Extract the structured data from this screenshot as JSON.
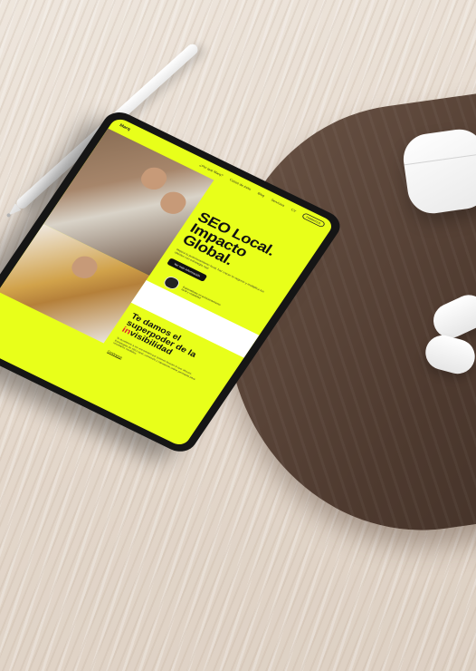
{
  "scene": {
    "description_colors": {
      "accent": "#e8ff1a",
      "wood_board": "#4e3a2f",
      "table": "#e4d8cc"
    }
  },
  "site": {
    "logo": "Marq",
    "nav_items": [
      "¿Por qué Marq?",
      "Casos de éxito",
      "Blog",
      "Servicios",
      "CV"
    ],
    "contact_label": "Hablemos",
    "hero": {
      "title_line1": "SEO Local.",
      "title_line2": "Impacto",
      "title_line3": "Global.",
      "subtitle": "Mejora tu posicionamiento local, haz crecer tu negocio y multiplica tus clientes con estrategia real.",
      "cta_label": "Ver más información"
    },
    "badge_text": "Especialistas en posicionamiento local y visibilidad",
    "section": {
      "title_line1": "Te damos el",
      "title_line2": "superpoder de la",
      "title_red": "in",
      "title_line3_rest": "visibilidad",
      "body": "Te ayudamos a ser encontrado por quienes buscan lo que ofreces. Estrategias de SEO local, contenido y reputación online pensadas para resultados medibles.",
      "link_label": "Conócenos"
    }
  }
}
